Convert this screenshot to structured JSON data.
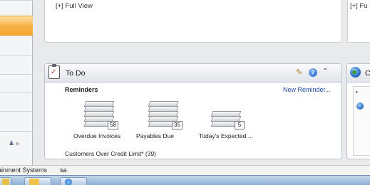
{
  "panels": {
    "top_left_link": "[+] Full View",
    "top_right_link": "[+] Fu"
  },
  "todo": {
    "title": "To Do",
    "reminders_label": "Reminders",
    "new_reminder_link": "New Reminder...",
    "items": [
      {
        "label": "Overdue Invoices",
        "count": "58"
      },
      {
        "label": "Payables Due",
        "count": "35"
      },
      {
        "label": "Today's Expected ...",
        "count": "5"
      }
    ],
    "customers_line": "Customers Over Credit Limit* (39)"
  },
  "right_panel": {
    "title_fragment": "C"
  },
  "status_bar": {
    "company": "ainment Systems",
    "user": "sa"
  },
  "icons": {
    "todo": "clipboard-icon",
    "edit": "pencil-icon",
    "help": "help-icon",
    "collapse": "chevron-up-icon",
    "right_panel": "globe-icon",
    "sidebar_more": "people-icon"
  },
  "colors": {
    "selected_nav": "#f7b046",
    "link": "#1f4aa8"
  }
}
